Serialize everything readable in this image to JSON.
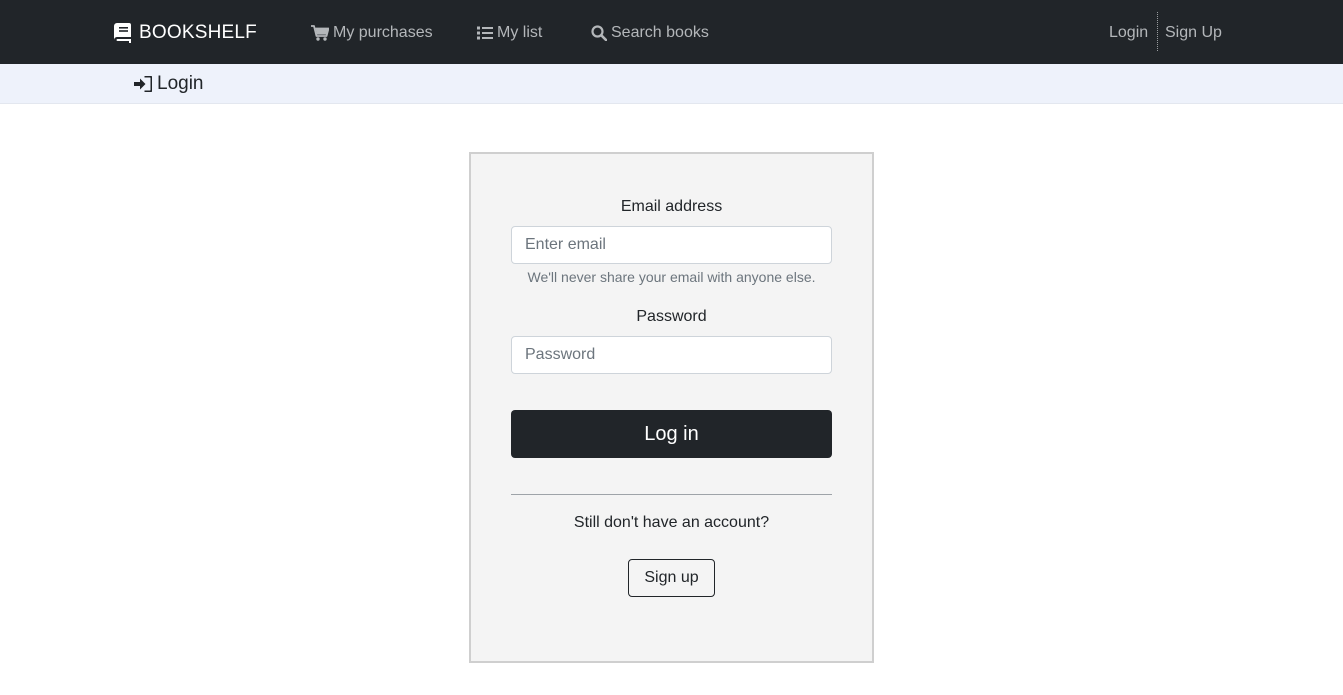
{
  "navbar": {
    "brand": {
      "label": "BOOKSHELF",
      "icon": "book-icon"
    },
    "links": [
      {
        "label": "My purchases",
        "icon": "cart-icon"
      },
      {
        "label": "My list",
        "icon": "list-icon"
      },
      {
        "label": "Search books",
        "icon": "search-icon"
      }
    ],
    "auth": {
      "login_label": "Login",
      "signup_label": "Sign Up"
    }
  },
  "subheader": {
    "title": "Login",
    "icon": "sign-in-icon"
  },
  "login_form": {
    "email_label": "Email address",
    "email_placeholder": "Enter email",
    "email_value": "",
    "email_help": "We'll never share your email with anyone else.",
    "password_label": "Password",
    "password_placeholder": "Password",
    "password_value": "",
    "submit_label": "Log in",
    "signup_prompt": "Still don't have an account?",
    "signup_button_label": "Sign up"
  },
  "colors": {
    "navbar_bg": "#212529",
    "nav_link": "#b4b7ba",
    "subheader_bg": "#eef2fb",
    "card_bg": "#f4f4f4",
    "primary_button": "#212529"
  }
}
